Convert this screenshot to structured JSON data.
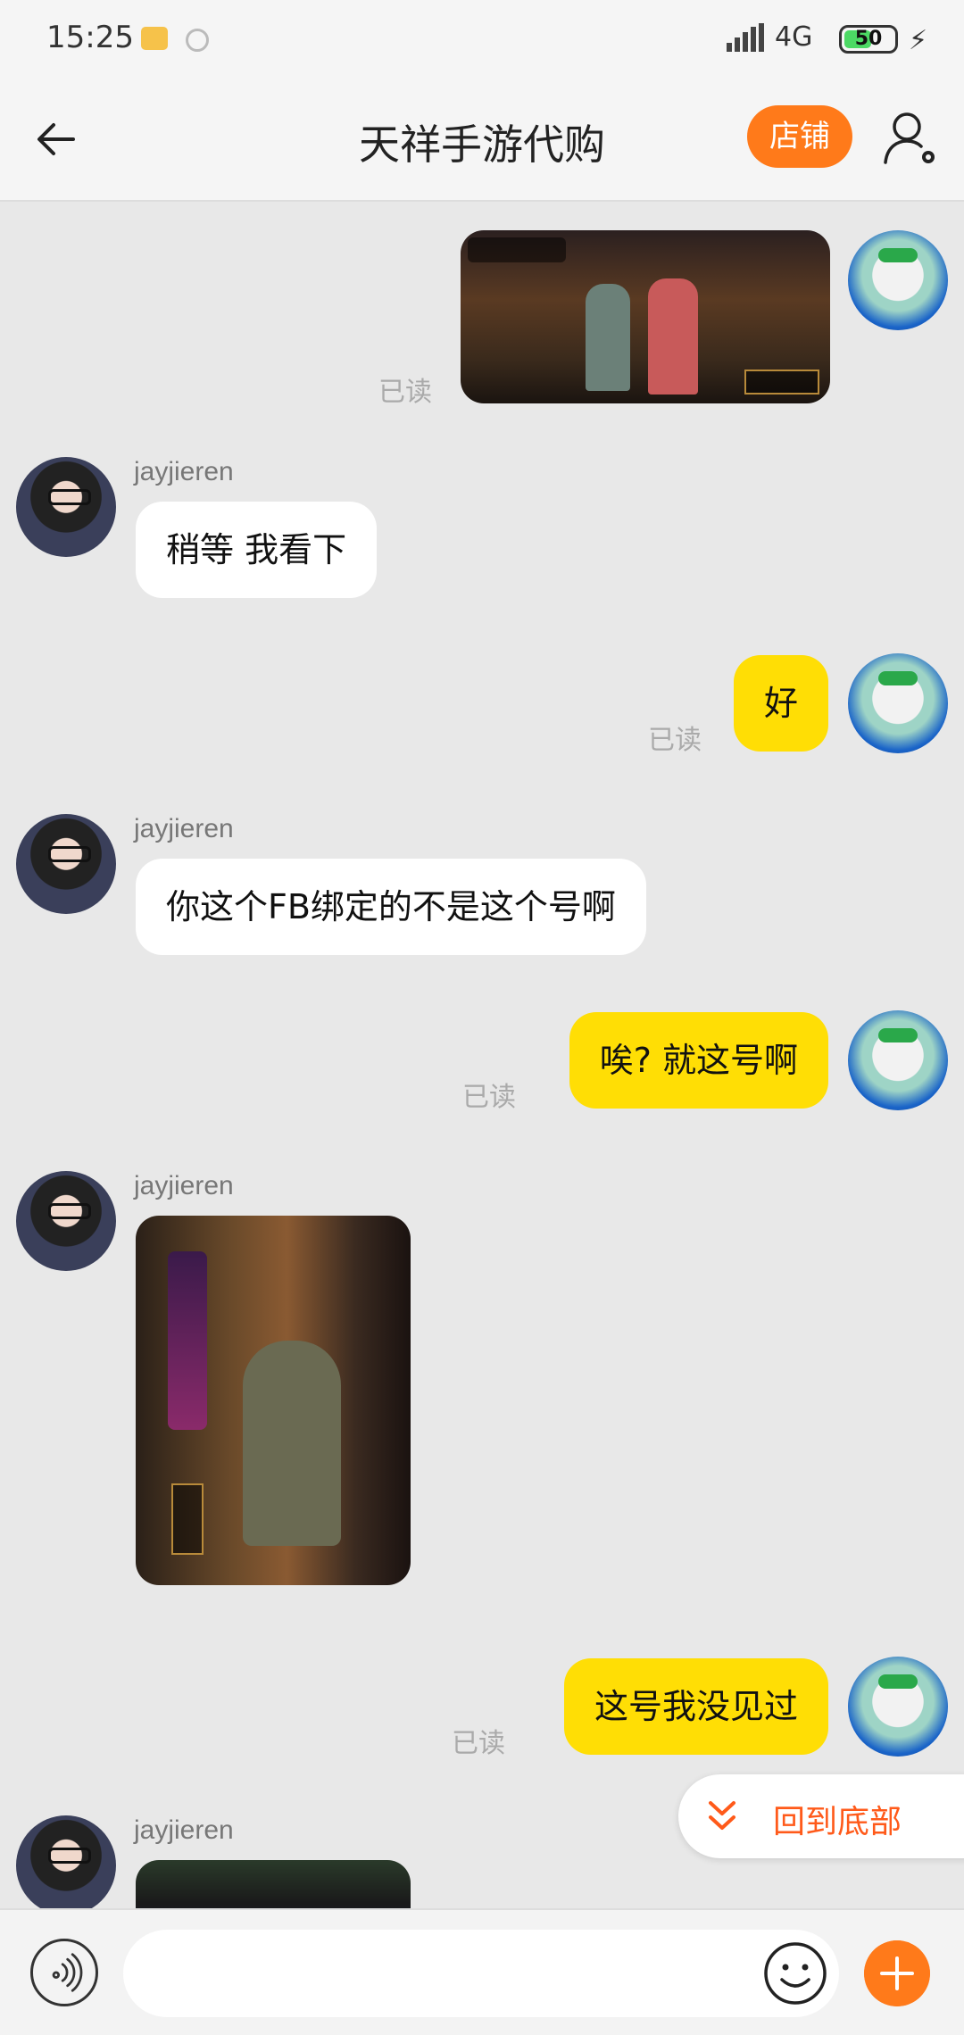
{
  "status_bar": {
    "time": "15:25",
    "network": "4G",
    "battery": "50"
  },
  "header": {
    "title": "天祥手游代购",
    "shop_label": "店铺"
  },
  "messages": [
    {
      "side": "right",
      "type": "image",
      "read_label": "已读"
    },
    {
      "side": "left",
      "sender": "jayjieren",
      "type": "text",
      "text": "稍等 我看下"
    },
    {
      "side": "right",
      "type": "text",
      "text": "好",
      "read_label": "已读"
    },
    {
      "side": "left",
      "sender": "jayjieren",
      "type": "text",
      "text": "你这个FB绑定的不是这个号啊"
    },
    {
      "side": "right",
      "type": "text",
      "text": "唉? 就这号啊",
      "read_label": "已读"
    },
    {
      "side": "left",
      "sender": "jayjieren",
      "type": "image"
    },
    {
      "side": "right",
      "type": "text",
      "text": "这号我没见过",
      "read_label": "已读"
    },
    {
      "side": "left",
      "sender": "jayjieren",
      "type": "image"
    }
  ],
  "scroll_bottom_label": "回到底部",
  "input": {
    "placeholder": ""
  },
  "colors": {
    "accent": "#ff7a1a",
    "bubble_self": "#ffde05",
    "bubble_other": "#ffffff",
    "background": "#e8e8e8"
  }
}
